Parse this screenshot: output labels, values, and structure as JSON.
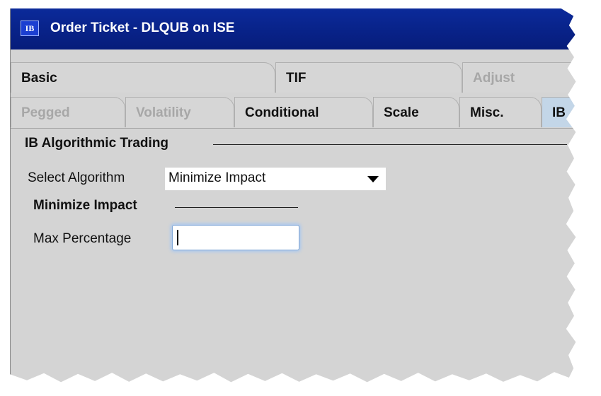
{
  "window": {
    "icon_text": "IB",
    "title": "Order Ticket - DLQUB on ISE"
  },
  "tabs": {
    "row1": [
      {
        "label": "Basic",
        "state": "enabled"
      },
      {
        "label": "TIF",
        "state": "enabled"
      },
      {
        "label": "Adjust",
        "state": "disabled"
      }
    ],
    "row2": [
      {
        "label": "Pegged",
        "state": "disabled"
      },
      {
        "label": "Volatility",
        "state": "disabled"
      },
      {
        "label": "Conditional",
        "state": "enabled"
      },
      {
        "label": "Scale",
        "state": "enabled"
      },
      {
        "label": "Misc.",
        "state": "enabled"
      },
      {
        "label": "IB",
        "state": "selected"
      }
    ]
  },
  "algo": {
    "section_title": "IB Algorithmic Trading",
    "select_label": "Select Algorithm",
    "selected_algorithm": "Minimize Impact",
    "params_title": "Minimize Impact",
    "max_percentage_label": "Max Percentage",
    "max_percentage_value": ""
  },
  "colors": {
    "titlebar": "#0b2a9a",
    "panel": "#d4d4d4",
    "selected_tab": "#c3d6e8",
    "input_focus": "#a9c8f0"
  }
}
